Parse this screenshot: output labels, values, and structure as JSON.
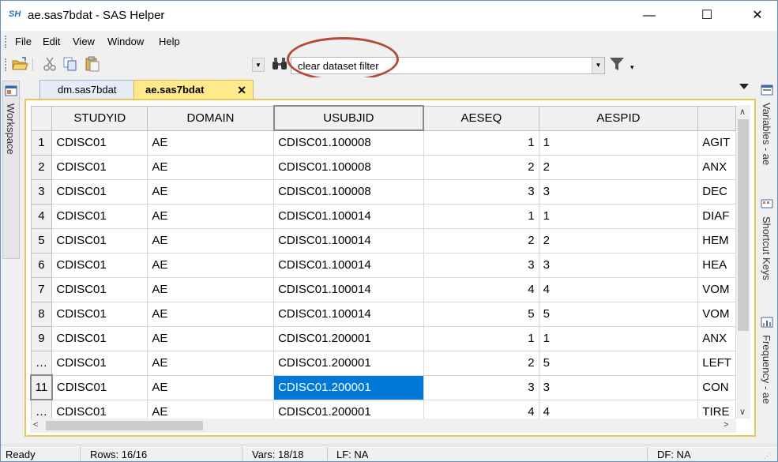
{
  "window": {
    "app_icon_text": "SH",
    "title": "ae.sas7bdat - SAS Helper",
    "minimize": "—",
    "maximize": "☐",
    "close": "✕"
  },
  "menu": [
    "File",
    "Edit",
    "View",
    "Window",
    "Help"
  ],
  "toolbar": {
    "filter_text": "clear dataset filter"
  },
  "left_tabs": {
    "workspace": "Workspace"
  },
  "right_tabs": {
    "variables": "Variables - ae",
    "shortcuts": "Shortcut Keys",
    "frequency": "Frequency - ae"
  },
  "doc_tabs": [
    {
      "label": "dm.sas7bdat"
    },
    {
      "label": "ae.sas7bdat",
      "active": true
    }
  ],
  "grid": {
    "columns": [
      "STUDYID",
      "DOMAIN",
      "USUBJID",
      "AESEQ",
      "AESPID",
      ""
    ],
    "rows": [
      {
        "row": "1",
        "studyid": "CDISC01",
        "domain": "AE",
        "usubjid": "CDISC01.100008",
        "aeseq": "1",
        "aespid": "1",
        "term": "AGIT"
      },
      {
        "row": "2",
        "studyid": "CDISC01",
        "domain": "AE",
        "usubjid": "CDISC01.100008",
        "aeseq": "2",
        "aespid": "2",
        "term": "ANX"
      },
      {
        "row": "3",
        "studyid": "CDISC01",
        "domain": "AE",
        "usubjid": "CDISC01.100008",
        "aeseq": "3",
        "aespid": "3",
        "term": "DEC"
      },
      {
        "row": "4",
        "studyid": "CDISC01",
        "domain": "AE",
        "usubjid": "CDISC01.100014",
        "aeseq": "1",
        "aespid": "1",
        "term": "DIAF"
      },
      {
        "row": "5",
        "studyid": "CDISC01",
        "domain": "AE",
        "usubjid": "CDISC01.100014",
        "aeseq": "2",
        "aespid": "2",
        "term": "HEM"
      },
      {
        "row": "6",
        "studyid": "CDISC01",
        "domain": "AE",
        "usubjid": "CDISC01.100014",
        "aeseq": "3",
        "aespid": "3",
        "term": "HEA"
      },
      {
        "row": "7",
        "studyid": "CDISC01",
        "domain": "AE",
        "usubjid": "CDISC01.100014",
        "aeseq": "4",
        "aespid": "4",
        "term": "VOM"
      },
      {
        "row": "8",
        "studyid": "CDISC01",
        "domain": "AE",
        "usubjid": "CDISC01.100014",
        "aeseq": "5",
        "aespid": "5",
        "term": "VOM"
      },
      {
        "row": "9",
        "studyid": "CDISC01",
        "domain": "AE",
        "usubjid": "CDISC01.200001",
        "aeseq": "1",
        "aespid": "1",
        "term": "ANX"
      },
      {
        "row": "…",
        "studyid": "CDISC01",
        "domain": "AE",
        "usubjid": "CDISC01.200001",
        "aeseq": "2",
        "aespid": "5",
        "term": "LEFT"
      },
      {
        "row": "11",
        "studyid": "CDISC01",
        "domain": "AE",
        "usubjid": "CDISC01.200001",
        "aeseq": "3",
        "aespid": "3",
        "term": "CON"
      },
      {
        "row": "…",
        "studyid": "CDISC01",
        "domain": "AE",
        "usubjid": "CDISC01.200001",
        "aeseq": "4",
        "aespid": "4",
        "term": "TIRE"
      }
    ]
  },
  "status": {
    "ready": "Ready",
    "rows": "Rows: 16/16",
    "vars": "Vars: 18/18",
    "lf": "LF: NA",
    "df": "DF: NA"
  },
  "colors": {
    "active_tab": "#ffe98a",
    "selection": "#0078d7",
    "annotation_ring": "#b5493a"
  }
}
